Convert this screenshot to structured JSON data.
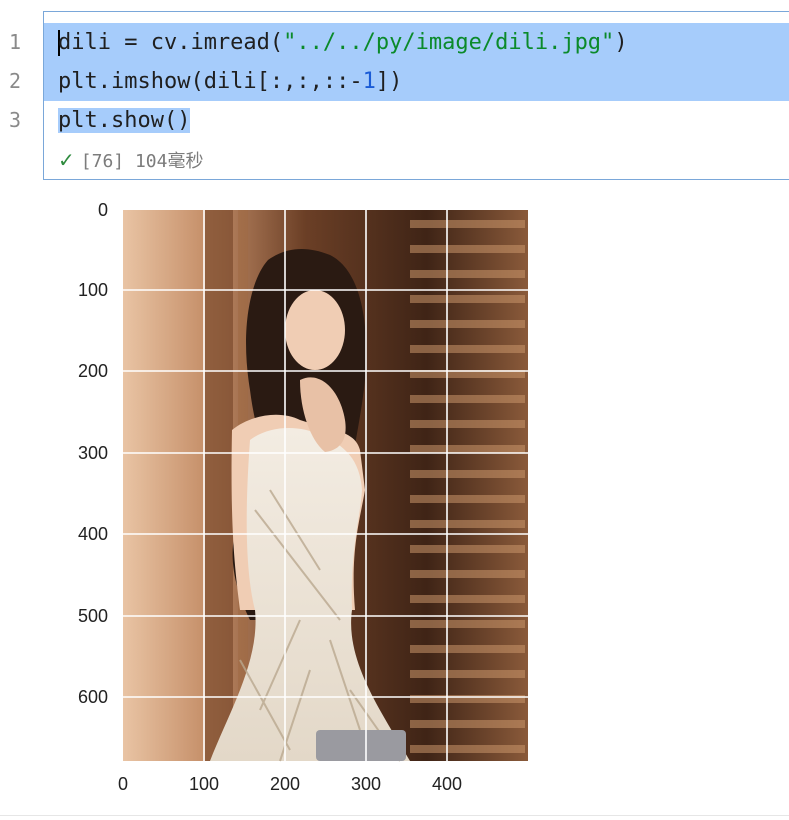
{
  "editor": {
    "line_numbers": [
      "1",
      "2",
      "3"
    ],
    "line1": {
      "a": "dili = cv.imread(",
      "b": "\"../../py/image/dili.jpg\"",
      "c": ")"
    },
    "line2": {
      "a": "plt.imshow(dili[:,:,::-",
      "b": "1",
      "c": "])"
    },
    "line3": {
      "a": "plt.show()"
    },
    "exec": {
      "count": "[76]",
      "time": "104毫秒"
    },
    "colors": {
      "selection": "#a6ccfb",
      "string": "#0b8a2a",
      "number": "#1a5bd6",
      "check": "#2e8b3e"
    },
    "icons": [
      "check-icon"
    ]
  },
  "plot": {
    "x_ticks": [
      "0",
      "100",
      "200",
      "300",
      "400"
    ],
    "y_ticks": [
      "0",
      "100",
      "200",
      "300",
      "400",
      "500",
      "600"
    ],
    "xlim": [
      0,
      499
    ],
    "ylim": [
      0,
      680
    ],
    "grid": true
  }
}
